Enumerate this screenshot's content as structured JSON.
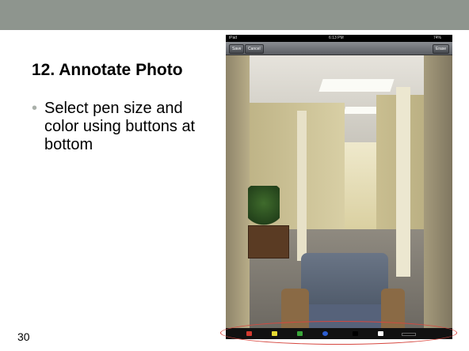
{
  "slide": {
    "title": "12. Annotate Photo",
    "bullet_marker": "•",
    "bullet_text": "Select pen size and color using buttons at bottom",
    "page_number": "30"
  },
  "ipad": {
    "status_bar": {
      "carrier": "iPad",
      "time": "6:13 PM",
      "battery": "74%"
    },
    "toolbar": {
      "save_label": "Save",
      "cancel_label": "Cancel",
      "erase_label": "Erase"
    },
    "palette": {
      "colors": [
        {
          "name": "red",
          "hex": "#d23a2f"
        },
        {
          "name": "yellow",
          "hex": "#e6d932"
        },
        {
          "name": "green",
          "hex": "#3aa63a"
        },
        {
          "name": "blue",
          "hex": "#2d5ed1"
        },
        {
          "name": "black",
          "hex": "#000000"
        },
        {
          "name": "white",
          "hex": "#ffffff"
        }
      ]
    }
  },
  "colors": {
    "top_band": "#8e958e",
    "callout": "#d6473f"
  }
}
